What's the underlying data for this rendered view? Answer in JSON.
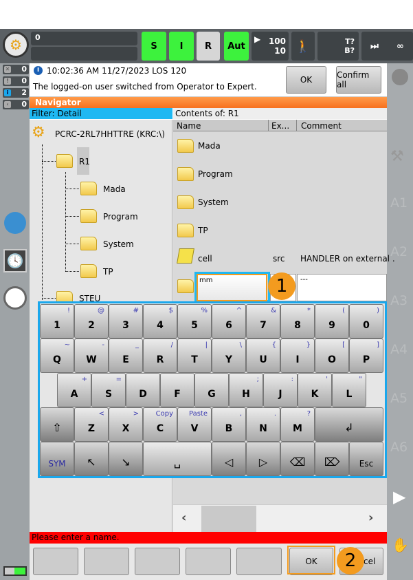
{
  "topbar": {
    "program_line": "0",
    "status_s": "S",
    "status_i": "I",
    "status_r": "R",
    "mode": "Aut",
    "override_prog": "100",
    "override_jog": "10",
    "tool": "T?",
    "base": "B?",
    "run_mode": "∞"
  },
  "counters": [
    "0",
    "0",
    "2",
    "0"
  ],
  "message": {
    "header": "10:02:36 AM 11/27/2023 LOS 120",
    "text": "The logged-on user switched from Operator to Expert.",
    "ok": "OK",
    "confirm_all": "Confirm all"
  },
  "navigator": {
    "title": "Navigator",
    "filter": "Filter: Detail",
    "contents_of": "Contents of: R1",
    "tree": {
      "root": "PCRC-2RL7HHTTRE (KRC:\\)",
      "r1": "R1",
      "children": [
        "Mada",
        "Program",
        "System",
        "TP"
      ],
      "steu": "STEU"
    },
    "columns": {
      "name": "Name",
      "ext": "Ex...",
      "comment": "Comment"
    },
    "rows": [
      {
        "name": "Mada"
      },
      {
        "name": "Program"
      },
      {
        "name": "System"
      },
      {
        "name": "TP"
      },
      {
        "name": "cell",
        "ext": "src",
        "comment": "HANDLER on external ."
      }
    ],
    "edit_row": {
      "name_value": "mm",
      "comment_value": "---"
    }
  },
  "axes": [
    "A1",
    "A2",
    "A3",
    "A4",
    "A5",
    "A6"
  ],
  "keyboard": {
    "rows": [
      [
        [
          "1",
          "!"
        ],
        [
          "2",
          "@"
        ],
        [
          "3",
          "#"
        ],
        [
          "4",
          "$"
        ],
        [
          "5",
          "%"
        ],
        [
          "6",
          "^"
        ],
        [
          "7",
          "&"
        ],
        [
          "8",
          "*"
        ],
        [
          "9",
          "("
        ],
        [
          "0",
          ")"
        ]
      ],
      [
        [
          "Q",
          "~"
        ],
        [
          "W",
          "-"
        ],
        [
          "E",
          "_"
        ],
        [
          "R",
          "/"
        ],
        [
          "T",
          "|"
        ],
        [
          "Y",
          "\\"
        ],
        [
          "U",
          "{"
        ],
        [
          "I",
          "}"
        ],
        [
          "O",
          "["
        ],
        [
          "P",
          "]"
        ]
      ],
      [
        [
          "A",
          "+"
        ],
        [
          "S",
          "="
        ],
        [
          "D",
          ""
        ],
        [
          "F",
          ""
        ],
        [
          "G",
          ""
        ],
        [
          "H",
          ";"
        ],
        [
          "J",
          ":"
        ],
        [
          "K",
          "'"
        ],
        [
          "L",
          "\""
        ]
      ],
      [
        [
          "⇧",
          ""
        ],
        [
          "Z",
          "<"
        ],
        [
          "X",
          ">"
        ],
        [
          "C",
          "Copy"
        ],
        [
          "V",
          "Paste"
        ],
        [
          "B",
          ","
        ],
        [
          "N",
          "."
        ],
        [
          "M",
          "?"
        ],
        [
          "↲",
          ""
        ]
      ],
      [
        [
          "SYM",
          ""
        ],
        [
          "↖",
          ""
        ],
        [
          "↘",
          ""
        ],
        [
          "␣",
          ""
        ],
        [
          "◁",
          ""
        ],
        [
          "▷",
          ""
        ],
        [
          "⌫",
          ""
        ],
        [
          "⌦",
          ""
        ],
        [
          "Esc",
          ""
        ]
      ]
    ]
  },
  "status_message": "Please enter a name.",
  "softkeys": {
    "ok": "OK",
    "cancel": "Cancel"
  },
  "annotations": [
    "1",
    "2"
  ],
  "colors": {
    "accent_orange": "#f7801e",
    "filter_blue": "#1fb8f2",
    "error_red": "#ff0000",
    "keyboard_border": "#1aa7ec"
  }
}
